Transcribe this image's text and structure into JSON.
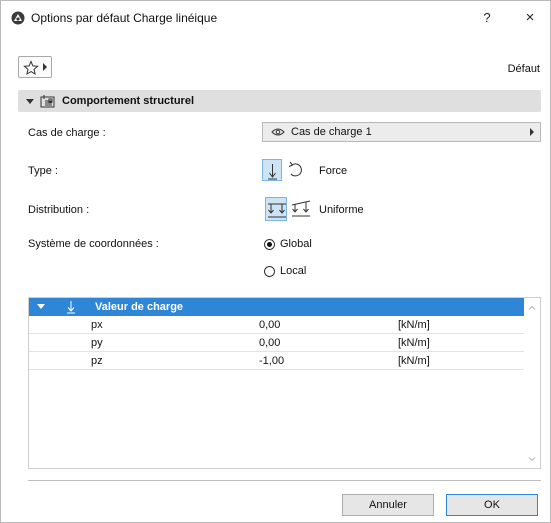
{
  "window": {
    "title": "Options par défaut Charge linéique",
    "help_label": "?",
    "close_label": "×"
  },
  "favorites": {
    "icon": "star-icon",
    "default_label": "Défaut"
  },
  "section": {
    "title": "Comportement structurel"
  },
  "fields": {
    "load_case": {
      "label": "Cas de charge :",
      "value": "Cas de charge 1"
    },
    "type": {
      "label": "Type :",
      "value": "Force"
    },
    "distribution": {
      "label": "Distribution :",
      "value": "Uniforme"
    },
    "coordinate_system": {
      "label": "Système de coordonnées :",
      "options": [
        "Global",
        "Local"
      ],
      "selected": "Global"
    }
  },
  "table": {
    "header": "Valeur de charge",
    "rows": [
      {
        "name": "px",
        "value": "0,00",
        "unit": "[kN/m]"
      },
      {
        "name": "py",
        "value": "0,00",
        "unit": "[kN/m]"
      },
      {
        "name": "pz",
        "value": "-1,00",
        "unit": "[kN/m]"
      }
    ]
  },
  "buttons": {
    "cancel": "Annuler",
    "ok": "OK"
  },
  "colors": {
    "accent": "#2f86d6",
    "selected_bg": "#cde4f7",
    "section_bg": "#dfdfdf"
  }
}
